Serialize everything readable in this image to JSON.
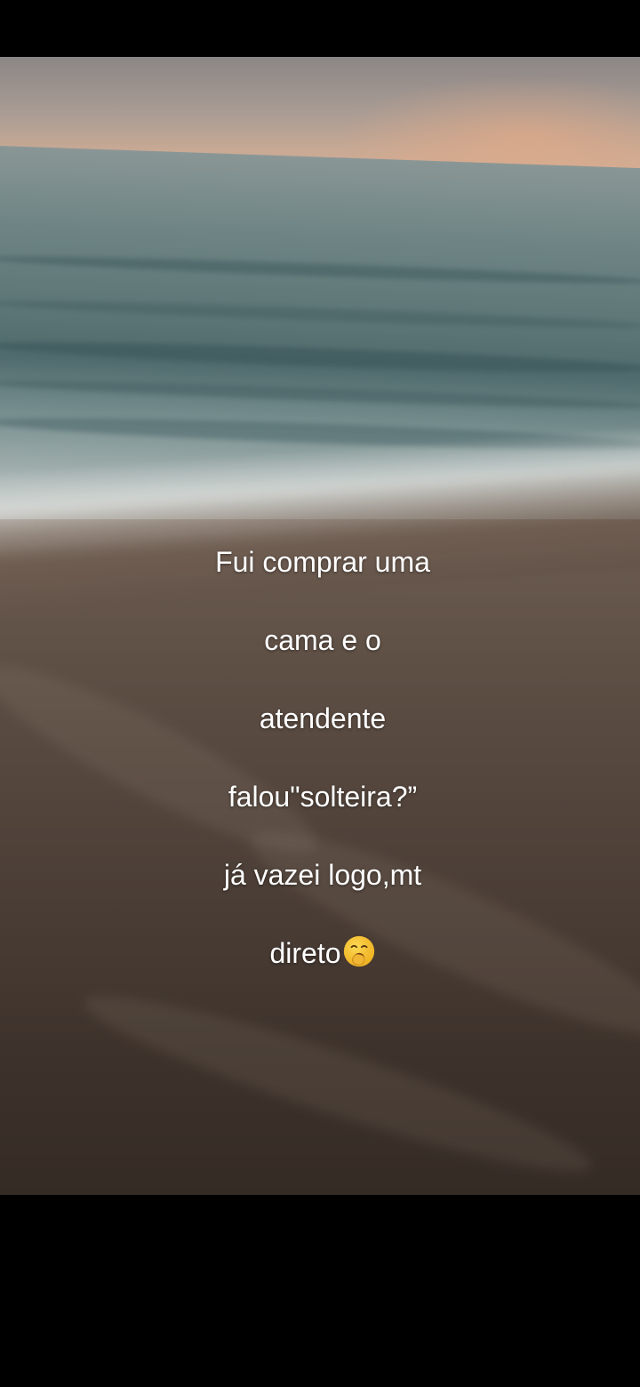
{
  "video": {
    "caption_lines": [
      "Fui comprar uma",
      "cama e o",
      "atendente",
      "falou\"solteira?”",
      "já vazei logo,mt",
      "direto"
    ],
    "caption_emoji": "yawning-face-emoji"
  },
  "colors": {
    "background": "#000000",
    "caption_text": "#ffffff",
    "sand": "#4b3e36",
    "sea": "#5f7777",
    "sky_glow": "#d7ae93"
  }
}
